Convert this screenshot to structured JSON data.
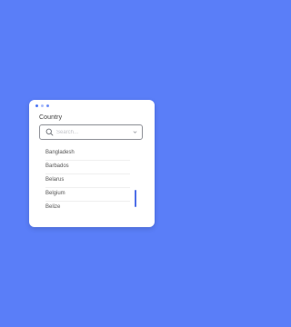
{
  "colors": {
    "background": "#5a7ef8",
    "accent": "#4f6fe8"
  },
  "window": {
    "controls": [
      "dot-blue",
      "dot-light",
      "dot-mid"
    ]
  },
  "field": {
    "label": "Country",
    "search_placeholder": "Search...",
    "search_value": ""
  },
  "list": {
    "items": [
      {
        "label": "Bangladesh"
      },
      {
        "label": "Barbados"
      },
      {
        "label": "Belarus"
      },
      {
        "label": "Belgium"
      },
      {
        "label": "Belize"
      }
    ]
  },
  "icons": {
    "search": "search-icon",
    "chevron": "chevron-down-icon"
  }
}
